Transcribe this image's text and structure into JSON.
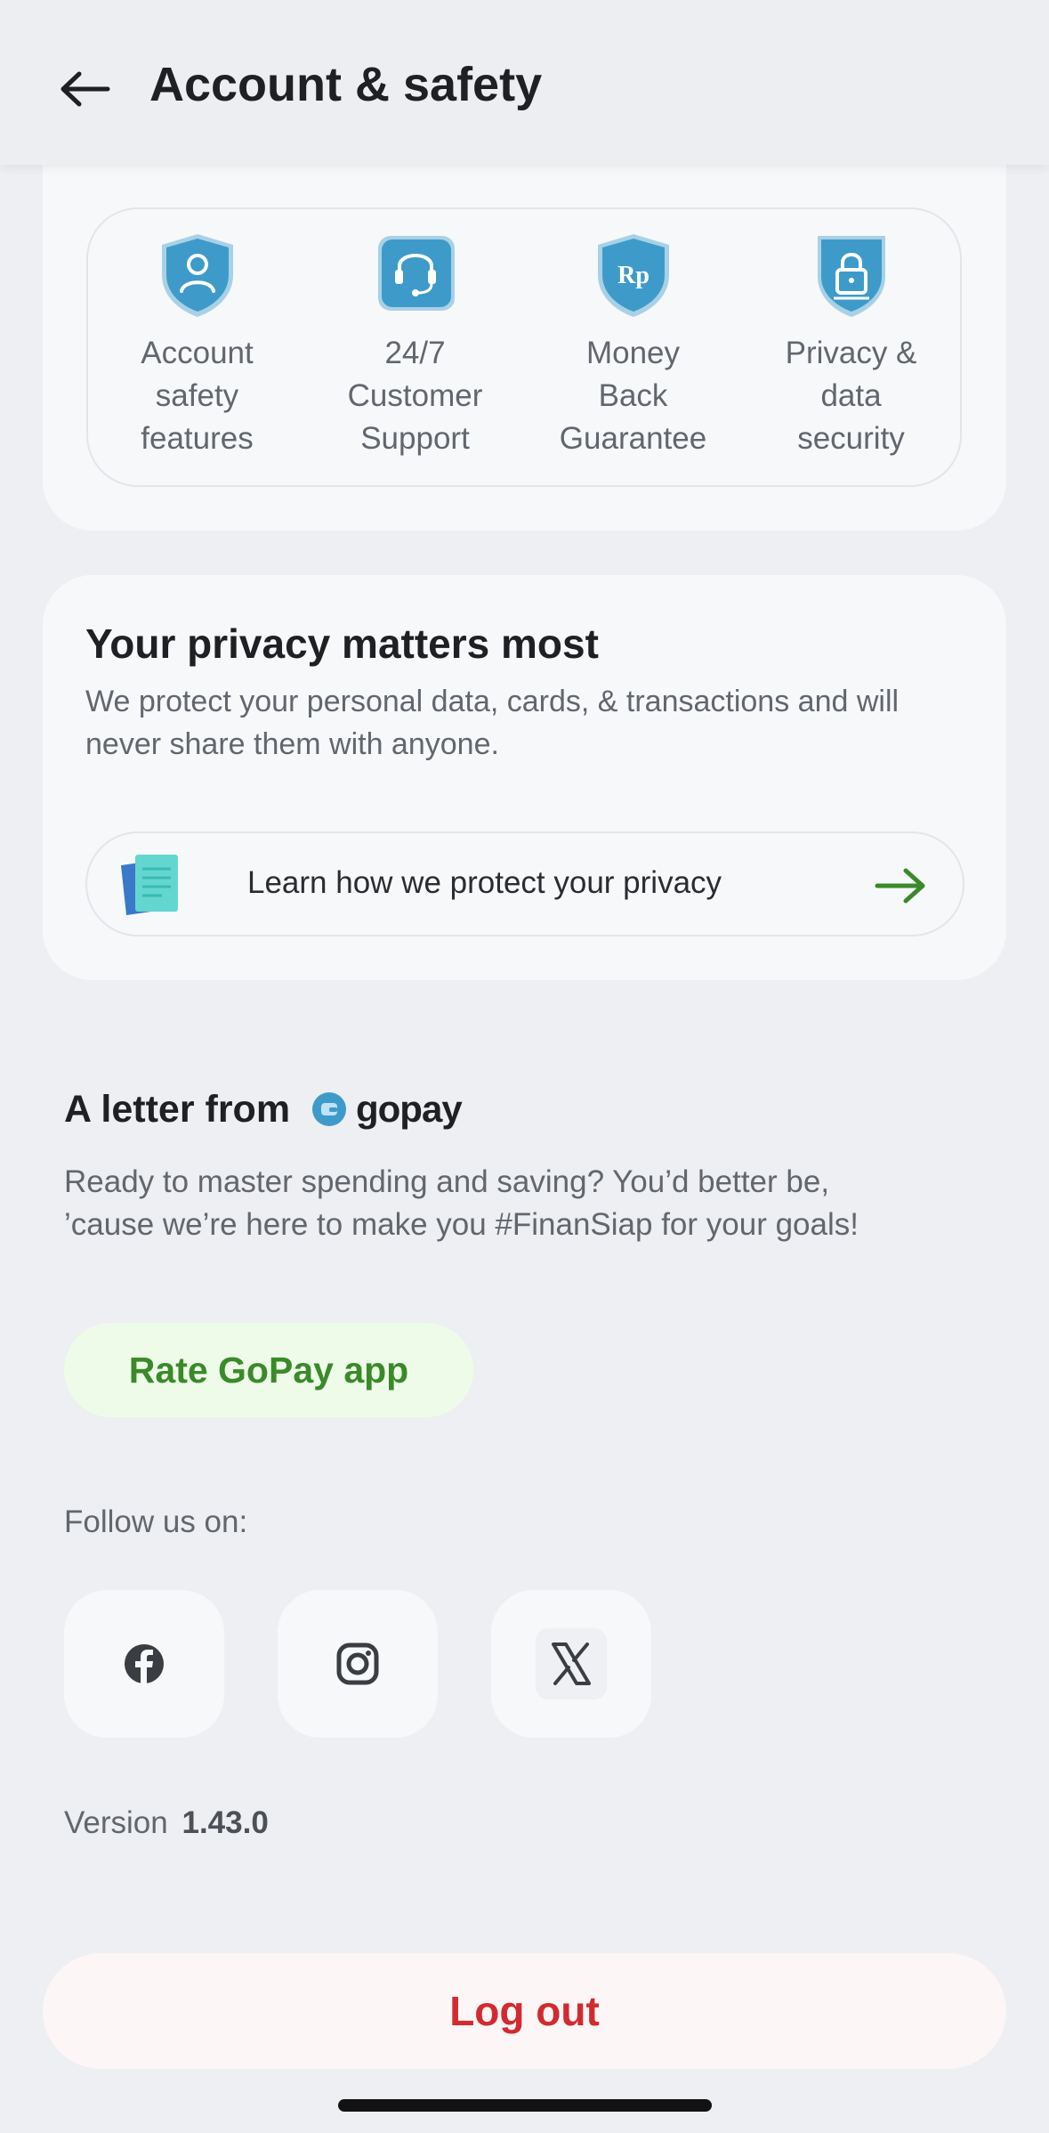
{
  "header": {
    "title": "Account & safety",
    "back_icon": "arrow-left-icon"
  },
  "features": [
    {
      "label": "Account\nsafety\nfeatures",
      "icon": "user-shield-icon"
    },
    {
      "label": "24/7\nCustomer\nSupport",
      "icon": "headset-chat-icon"
    },
    {
      "label": "Money\nBack\nGuarantee",
      "icon": "rp-shield-icon"
    },
    {
      "label": "Privacy &\ndata\nsecurity",
      "icon": "lock-shield-icon"
    }
  ],
  "privacy": {
    "title": "Your privacy matters most",
    "description": "We protect your personal data, cards, & transactions and will never share them with anyone.",
    "learn_label": "Learn how we protect your privacy"
  },
  "letter": {
    "title": "A letter from",
    "brand": "gopay",
    "body": "Ready to master spending and saving? You’d better be, ’cause we’re here to make you #FinanSiap for your goals!",
    "rate_label": "Rate GoPay app"
  },
  "follow": {
    "label": "Follow us on:",
    "socials": [
      "facebook-icon",
      "instagram-icon",
      "x-icon"
    ]
  },
  "version": {
    "label": "Version",
    "number": "1.43.0"
  },
  "logout_label": "Log out",
  "colors": {
    "accent_green": "#3a8a2a",
    "danger_red": "#d22a30",
    "icon_blue": "#3e9bc9"
  }
}
